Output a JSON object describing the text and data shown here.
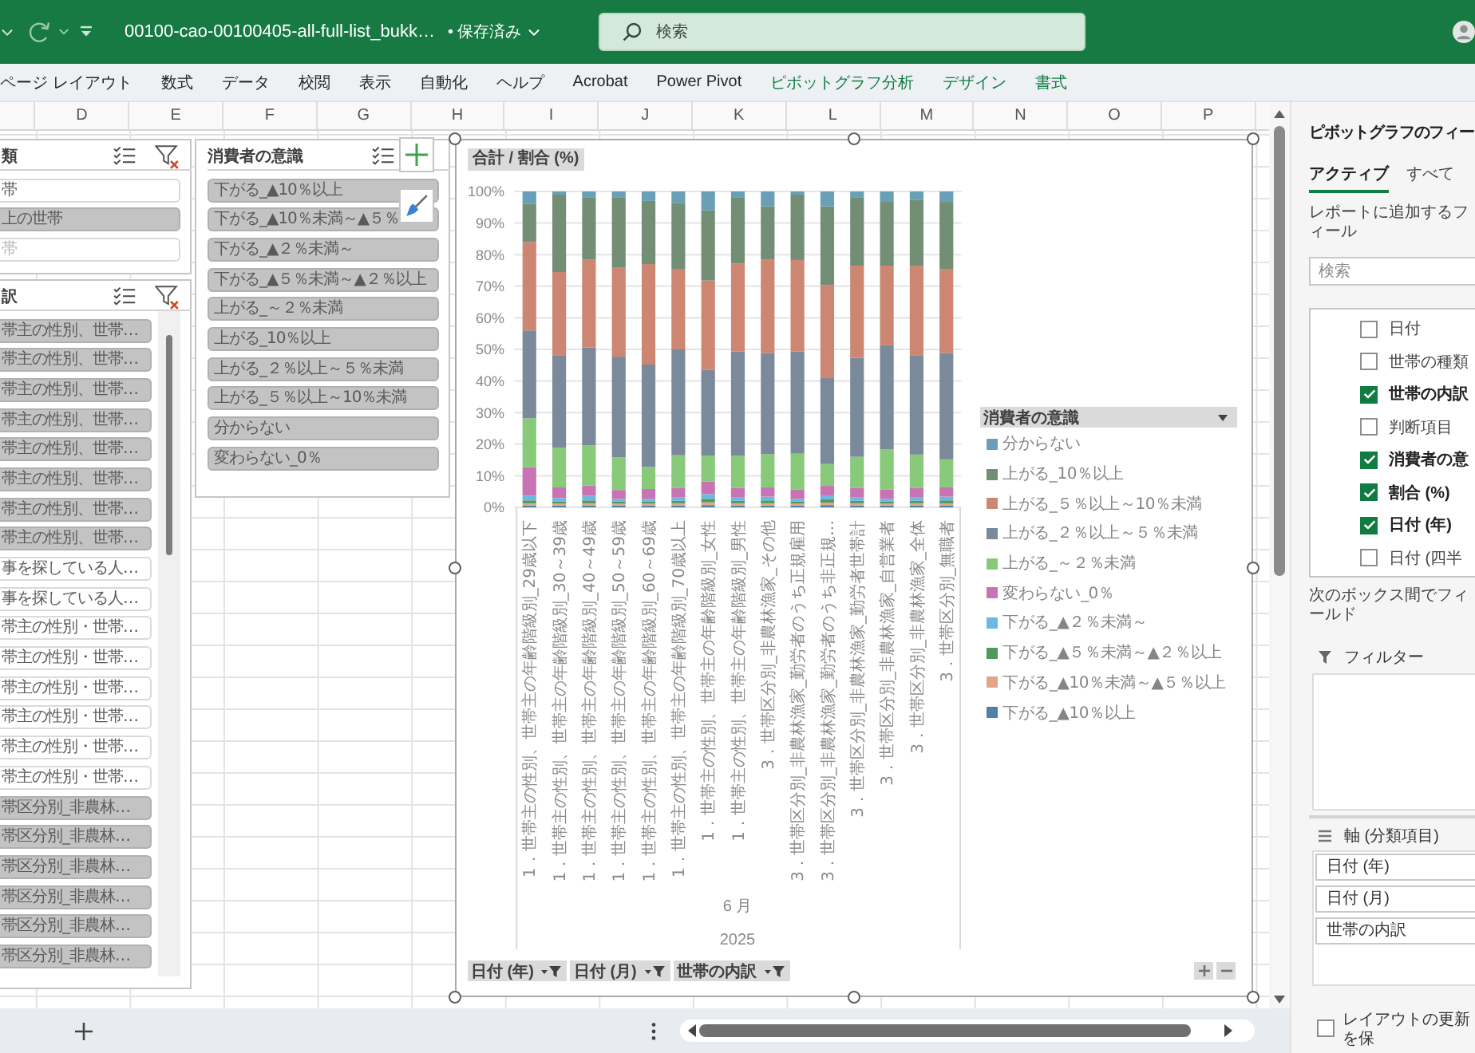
{
  "title_bar": {
    "file_name": "00100-cao-00100405-all-full-list_bukk…",
    "save_status": "• 保存済み",
    "search": {
      "placeholder": "検索"
    }
  },
  "ribbon_tabs": [
    {
      "label": "ページ レイアウト",
      "kind": "standard"
    },
    {
      "label": "数式",
      "kind": "standard"
    },
    {
      "label": "データ",
      "kind": "standard"
    },
    {
      "label": "校閲",
      "kind": "standard"
    },
    {
      "label": "表示",
      "kind": "standard"
    },
    {
      "label": "自動化",
      "kind": "standard"
    },
    {
      "label": "ヘルプ",
      "kind": "standard"
    },
    {
      "label": "Acrobat",
      "kind": "standard"
    },
    {
      "label": "Power Pivot",
      "kind": "standard"
    },
    {
      "label": "ピボットグラフ分析",
      "kind": "contextual"
    },
    {
      "label": "デザイン",
      "kind": "contextual"
    },
    {
      "label": "書式",
      "kind": "contextual"
    }
  ],
  "sheet": {
    "columns": [
      "D",
      "E",
      "F",
      "G",
      "H",
      "I",
      "J",
      "K",
      "L",
      "M",
      "N",
      "O",
      "P"
    ]
  },
  "slicers": [
    {
      "title": "類",
      "items": [
        {
          "label": "帯",
          "selected": false,
          "disabled": false
        },
        {
          "label": "上の世帯",
          "selected": true,
          "disabled": false
        },
        {
          "label": "帯",
          "selected": false,
          "disabled": true
        }
      ]
    },
    {
      "title": "訳",
      "items": [
        {
          "label": "帯主の性別、世帯…",
          "selected": true
        },
        {
          "label": "帯主の性別、世帯…",
          "selected": true
        },
        {
          "label": "帯主の性別、世帯…",
          "selected": true
        },
        {
          "label": "帯主の性別、世帯…",
          "selected": true
        },
        {
          "label": "帯主の性別、世帯…",
          "selected": true
        },
        {
          "label": "帯主の性別、世帯…",
          "selected": true
        },
        {
          "label": "帯主の性別、世帯…",
          "selected": true
        },
        {
          "label": "帯主の性別、世帯…",
          "selected": true
        },
        {
          "label": "事を探している人…",
          "selected": false
        },
        {
          "label": "事を探している人…",
          "selected": false
        },
        {
          "label": "帯主の性別・世帯…",
          "selected": false
        },
        {
          "label": "帯主の性別・世帯…",
          "selected": false
        },
        {
          "label": "帯主の性別・世帯…",
          "selected": false
        },
        {
          "label": "帯主の性別・世帯…",
          "selected": false
        },
        {
          "label": "帯主の性別・世帯…",
          "selected": false
        },
        {
          "label": "帯主の性別・世帯…",
          "selected": false
        },
        {
          "label": "帯区分別_非農林…",
          "selected": true
        },
        {
          "label": "帯区分別_非農林…",
          "selected": true
        },
        {
          "label": "帯区分別_非農林…",
          "selected": true
        },
        {
          "label": "帯区分別_非農林…",
          "selected": true
        },
        {
          "label": "帯区分別_非農林…",
          "selected": true
        },
        {
          "label": "帯区分別_非農林…",
          "selected": true
        }
      ]
    },
    {
      "title": "消費者の意識",
      "items": [
        {
          "label": "下がる_▲10％以上",
          "selected": true
        },
        {
          "label": "下がる_▲10％未満～▲５％",
          "selected": true
        },
        {
          "label": "下がる_▲２％未満～",
          "selected": true
        },
        {
          "label": "下がる_▲５％未満～▲２％以上",
          "selected": true
        },
        {
          "label": "上がる_～２％未満",
          "selected": true
        },
        {
          "label": "上がる_10％以上",
          "selected": true
        },
        {
          "label": "上がる_２％以上～５％未満",
          "selected": true
        },
        {
          "label": "上がる_５％以上～10％未満",
          "selected": true
        },
        {
          "label": "分からない",
          "selected": true
        },
        {
          "label": "変わらない_0％",
          "selected": true
        }
      ]
    }
  ],
  "chart": {
    "value_field": "合計 / 割合 (%)",
    "chart_data": {
      "type": "bar",
      "stacked": true,
      "grid": true,
      "categories": [
        "1．世帯主の性別、世帯主の年齢階級別_29歳以下",
        "1．世帯主の性別、世帯主の年齢階級別_30～39歳",
        "1．世帯主の性別、世帯主の年齢階級別_40～49歳",
        "1．世帯主の性別、世帯主の年齢階級別_50～59歳",
        "1．世帯主の性別、世帯主の年齢階級別_60～69歳",
        "1．世帯主の性別、世帯主の年齢階級別_70歳以上",
        "1．世帯主の性別、世帯主の年齢階級別_女性",
        "1．世帯主の性別、世帯主の年齢階級別_男性",
        "3．世帯区分別_非農林漁家_その他",
        "3．世帯区分別_非農林漁家_勤労者のうち正規雇用",
        "3．世帯区分別_非農林漁家_勤労者のうち非正規…",
        "3．世帯区分別_非農林漁家_勤労者世帯計",
        "3．世帯区分別_非農林漁家_自営業者",
        "3．世帯区分別_非農林漁家_全体",
        "3．世帯区分別_無職者"
      ],
      "series": [
        {
          "name": "下がる_▲10％以上",
          "color": "#4f81a8",
          "values": [
            0.006,
            0.006,
            0.006,
            0.006,
            0.006,
            0.006,
            0.007,
            0.006,
            0.006,
            0.006,
            0.007,
            0.006,
            0.006,
            0.006,
            0.006
          ]
        },
        {
          "name": "下がる_▲10％未満～▲５％以上",
          "color": "#e2a587",
          "values": [
            0.007,
            0.006,
            0.007,
            0.006,
            0.006,
            0.007,
            0.009,
            0.007,
            0.007,
            0.006,
            0.008,
            0.007,
            0.006,
            0.007,
            0.007
          ]
        },
        {
          "name": "下がる_▲５％未満～▲２％以上",
          "color": "#4e9a5c",
          "values": [
            0.009,
            0.007,
            0.009,
            0.007,
            0.007,
            0.008,
            0.011,
            0.008,
            0.009,
            0.007,
            0.01,
            0.008,
            0.007,
            0.008,
            0.009
          ]
        },
        {
          "name": "下がる_▲２％未満～",
          "color": "#6cb8e0",
          "values": [
            0.015,
            0.01,
            0.015,
            0.008,
            0.008,
            0.01,
            0.015,
            0.01,
            0.012,
            0.008,
            0.013,
            0.01,
            0.008,
            0.01,
            0.012
          ]
        },
        {
          "name": "変わらない_0％",
          "color": "#c873b4",
          "values": [
            0.09,
            0.034,
            0.032,
            0.028,
            0.031,
            0.03,
            0.04,
            0.031,
            0.029,
            0.03,
            0.03,
            0.03,
            0.029,
            0.03,
            0.029
          ]
        },
        {
          "name": "上がる_～２％未満",
          "color": "#88c97a",
          "values": [
            0.155,
            0.126,
            0.127,
            0.103,
            0.07,
            0.104,
            0.081,
            0.101,
            0.105,
            0.113,
            0.069,
            0.099,
            0.127,
            0.106,
            0.089
          ]
        },
        {
          "name": "上がる_２％以上～５％未満",
          "color": "#7a8a9b",
          "values": [
            0.278,
            0.291,
            0.31,
            0.319,
            0.324,
            0.335,
            0.273,
            0.331,
            0.321,
            0.324,
            0.272,
            0.313,
            0.33,
            0.313,
            0.337
          ]
        },
        {
          "name": "上がる_５％以上～10％未満",
          "color": "#cd8672",
          "values": [
            0.28,
            0.265,
            0.279,
            0.283,
            0.318,
            0.253,
            0.282,
            0.278,
            0.296,
            0.289,
            0.294,
            0.292,
            0.252,
            0.285,
            0.266
          ]
        },
        {
          "name": "上がる_10％以上",
          "color": "#728f75",
          "values": [
            0.12,
            0.245,
            0.195,
            0.22,
            0.2,
            0.211,
            0.222,
            0.208,
            0.168,
            0.207,
            0.25,
            0.215,
            0.202,
            0.209,
            0.212
          ]
        },
        {
          "name": "分からない",
          "color": "#6a9fb8",
          "values": [
            0.04,
            0.01,
            0.02,
            0.02,
            0.03,
            0.036,
            0.06,
            0.02,
            0.047,
            0.01,
            0.047,
            0.02,
            0.033,
            0.026,
            0.033
          ]
        }
      ],
      "ylim": [
        0,
        1
      ],
      "yticks": [
        {
          "value": 0,
          "label": "0%"
        },
        {
          "value": 0.1,
          "label": "10%"
        },
        {
          "value": 0.2,
          "label": "20%"
        },
        {
          "value": 0.3,
          "label": "30%"
        },
        {
          "value": 0.4,
          "label": "40%"
        },
        {
          "value": 0.5,
          "label": "50%"
        },
        {
          "value": 0.6,
          "label": "60%"
        },
        {
          "value": 0.7,
          "label": "70%"
        },
        {
          "value": 0.8,
          "label": "80%"
        },
        {
          "value": 0.9,
          "label": "90%"
        },
        {
          "value": 1,
          "label": "100%"
        }
      ]
    },
    "category_groups": [
      "6 月",
      "2025"
    ],
    "axis_fields": [
      "日付 (年)",
      "日付 (月)",
      "世帯の内訳"
    ],
    "legend_field": "消費者の意識"
  },
  "field_pane": {
    "title": "ピボットグラフのフィー",
    "tabs": [
      {
        "label": "アクティブ",
        "selected": true
      },
      {
        "label": "すべて",
        "selected": false
      }
    ],
    "instruction": "レポートに追加するフィール",
    "search": {
      "placeholder": "検索"
    },
    "fields": [
      {
        "label": "日付",
        "checked": false
      },
      {
        "label": "世帯の種類",
        "checked": false
      },
      {
        "label": "世帯の内訳",
        "checked": true
      },
      {
        "label": "判断項目",
        "checked": false
      },
      {
        "label": "消費者の意",
        "checked": true
      },
      {
        "label": "割合 (%)",
        "checked": true
      },
      {
        "label": "日付 (年)",
        "checked": true
      },
      {
        "label": "日付 (四半",
        "checked": false
      }
    ],
    "drag_hint": "次のボックス間でフィールド",
    "filters": {
      "title": "フィルター"
    },
    "axis": {
      "title": "軸 (分類項目)",
      "items": [
        "日付 (年)",
        "日付 (月)",
        "世帯の内訳"
      ]
    },
    "defer_update": {
      "label": "レイアウトの更新を保",
      "checked": false
    }
  }
}
